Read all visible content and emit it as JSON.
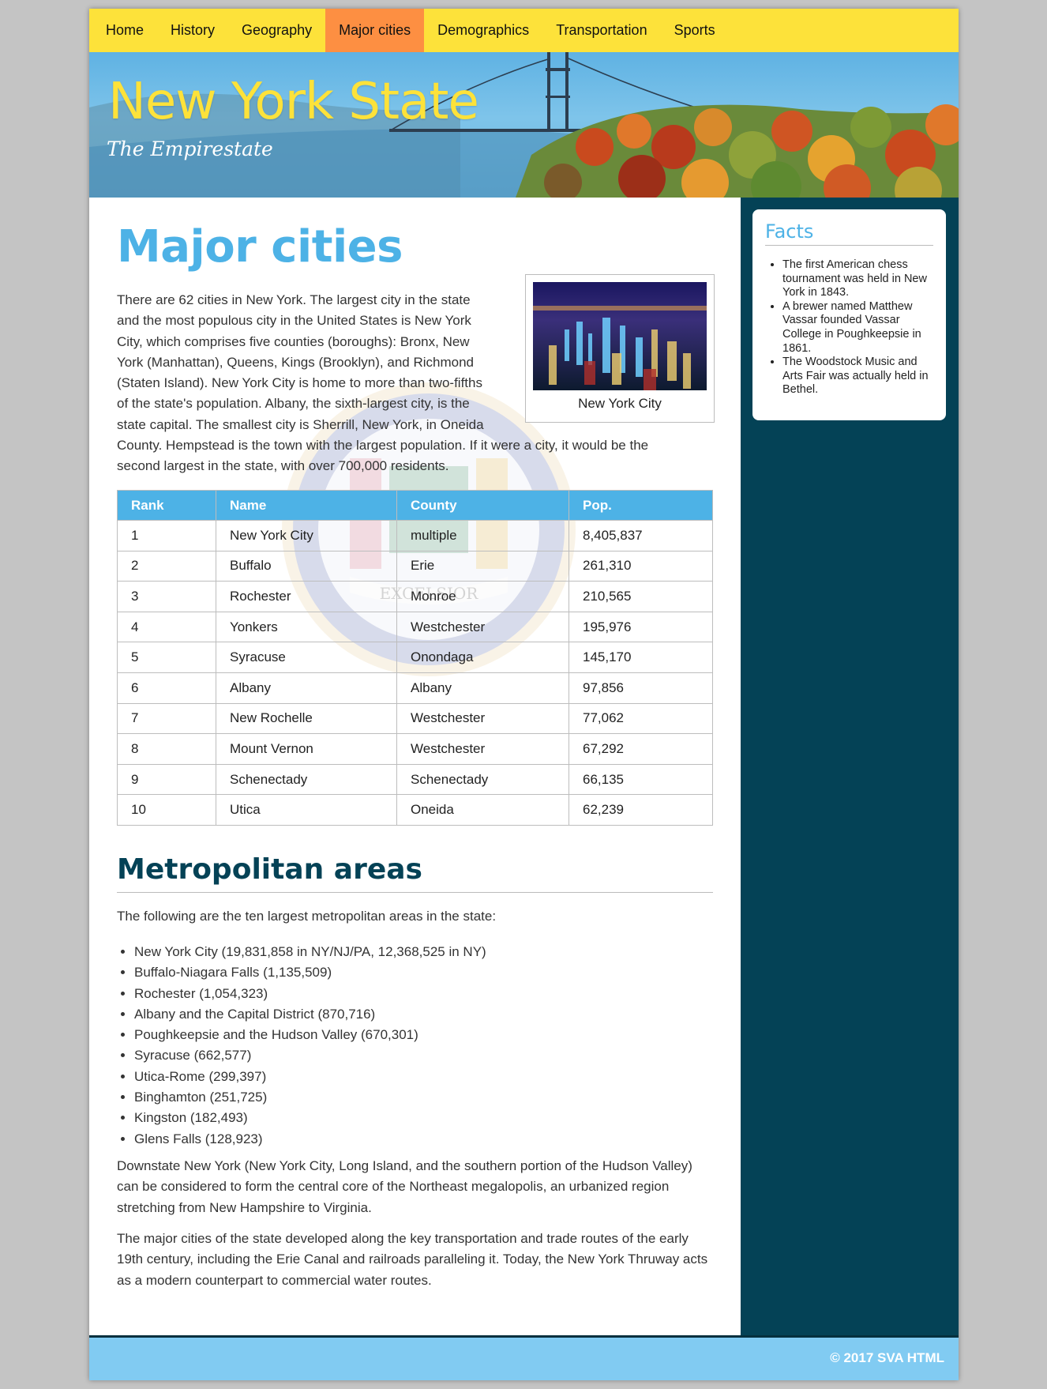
{
  "nav": {
    "items": [
      {
        "label": "Home"
      },
      {
        "label": "History"
      },
      {
        "label": "Geography"
      },
      {
        "label": "Major cities"
      },
      {
        "label": "Demographics"
      },
      {
        "label": "Transportation"
      },
      {
        "label": "Sports"
      }
    ],
    "active_index": 3
  },
  "header": {
    "title": "New York State",
    "tagline": "The Empirestate"
  },
  "main": {
    "heading": "Major cities",
    "intro": "There are 62 cities in New York. The largest city in the state and the most populous city in the United States is New York City, which comprises five counties (boroughs): Bronx, New York (Manhattan), Queens, Kings (Brooklyn), and Richmond (Staten Island). New York City is home to more than two-fifths of the state's population. Albany, the sixth-largest city, is the state capital. The smallest city is Sherrill, New York, in Oneida County. Hempstead is the town with the largest population. If it were a city, it would be the second largest in the state, with over 700,000 residents.",
    "figure_caption": "New York City",
    "seal_text": "EXCELSIOR",
    "table": {
      "headers": [
        "Rank",
        "Name",
        "County",
        "Pop."
      ],
      "rows": [
        [
          "1",
          "New York City",
          "multiple",
          "8,405,837"
        ],
        [
          "2",
          "Buffalo",
          "Erie",
          "261,310"
        ],
        [
          "3",
          "Rochester",
          "Monroe",
          "210,565"
        ],
        [
          "4",
          "Yonkers",
          "Westchester",
          "195,976"
        ],
        [
          "5",
          "Syracuse",
          "Onondaga",
          "145,170"
        ],
        [
          "6",
          "Albany",
          "Albany",
          "97,856"
        ],
        [
          "7",
          "New Rochelle",
          "Westchester",
          "77,062"
        ],
        [
          "8",
          "Mount Vernon",
          "Westchester",
          "67,292"
        ],
        [
          "9",
          "Schenectady",
          "Schenectady",
          "66,135"
        ],
        [
          "10",
          "Utica",
          "Oneida",
          "62,239"
        ]
      ]
    },
    "metro_heading": "Metropolitan areas",
    "metro_intro": "The following are the ten largest metropolitan areas in the state:",
    "metro_list": [
      "New York City (19,831,858 in NY/NJ/PA, 12,368,525 in NY)",
      "Buffalo-Niagara Falls (1,135,509)",
      "Rochester (1,054,323)",
      "Albany and the Capital District (870,716)",
      "Poughkeepsie and the Hudson Valley (670,301)",
      "Syracuse (662,577)",
      "Utica-Rome (299,397)",
      "Binghamton (251,725)",
      "Kingston (182,493)",
      "Glens Falls (128,923)"
    ],
    "downstate_para": "Downstate New York (New York City, Long Island, and the southern portion of the Hudson Valley) can be considered to form the central core of the Northeast megalopolis, an urbanized region stretching from New Hampshire to Virginia.",
    "cities_para": "The major cities of the state developed along the key transportation and trade routes of the early 19th century, including the Erie Canal and railroads paralleling it. Today, the New York Thruway acts as a modern counterpart to commercial water routes."
  },
  "sidebar": {
    "facts_title": "Facts",
    "facts": [
      "The first American chess tournament was held in New York in 1843.",
      "A brewer named Matthew Vassar founded Vassar College in Poughkeepsie in 1861.",
      "The Woodstock Music and Arts Fair was actually held in Bethel."
    ]
  },
  "footer": {
    "text": "© 2017 SVA HTML"
  },
  "colors": {
    "nav_bg": "#fde23a",
    "nav_active": "#fd8f42",
    "accent_blue": "#4db2e6",
    "sidebar_bg": "#044256",
    "footer_bg": "#81cbf2"
  }
}
